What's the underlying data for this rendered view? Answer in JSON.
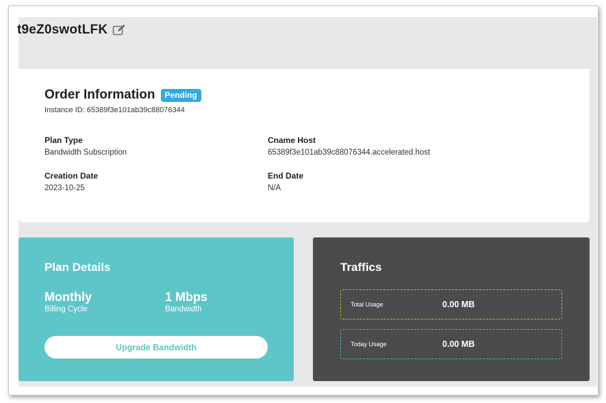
{
  "header": {
    "title": "t9eZ0swotLFK"
  },
  "order": {
    "title": "Order Information",
    "status_badge": "Pending",
    "instance_label": "Instance ID: 65389f3e101ab39c88076344",
    "fields": {
      "plan_type": {
        "label": "Plan Type",
        "value": "Bandwidth Subscription"
      },
      "cname_host": {
        "label": "Cname Host",
        "value": "65389f3e101ab39c88076344.accelerated.host"
      },
      "creation_date": {
        "label": "Creation Date",
        "value": "2023-10-25"
      },
      "end_date": {
        "label": "End Date",
        "value": "N/A"
      }
    }
  },
  "plan": {
    "title": "Plan Details",
    "billing": {
      "value": "Monthly",
      "label": "Billing Cycle"
    },
    "bandwidth": {
      "value": "1 Mbps",
      "label": "Bandwidth"
    },
    "upgrade_label": "Upgrade Bandwidth"
  },
  "traffics": {
    "title": "Traffics",
    "total": {
      "label": "Total Usage",
      "value": "0.00 MB"
    },
    "today": {
      "label": "Today Usage",
      "value": "0.00 MB"
    }
  },
  "colors": {
    "plan_card": "#5ec5c9",
    "traffic_card": "#4b4b4b",
    "badge": "#33a9e0",
    "total_border": "#c6b33a",
    "today_border": "#3fb7c2"
  },
  "icons": {
    "edit": "edit-icon"
  }
}
